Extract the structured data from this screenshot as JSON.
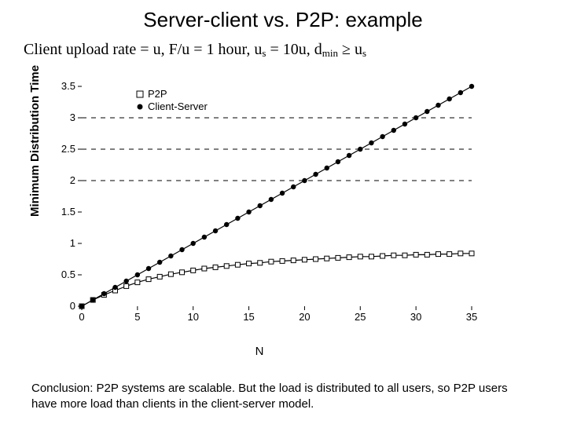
{
  "title": "Server-client vs. P2P: example",
  "assumptions_html": "Client upload rate = u,  F/u = 1 hour,  u<sub>s</sub> = 10u,  d<sub>min</sub> ≥ u<sub>s</sub>",
  "conclusion": "Conclusion: P2P systems are scalable. But the load is distributed to all users, so P2P users have more load than clients in the client-server model.",
  "ylabel": "Minimum Distribution Time",
  "xlabel": "N",
  "legend": {
    "p2p": "P2P",
    "cs": "Client-Server"
  },
  "chart_data": {
    "type": "line",
    "title": "",
    "xlabel": "N",
    "ylabel": "Minimum Distribution Time",
    "xlim": [
      0,
      35
    ],
    "ylim": [
      0,
      3.5
    ],
    "xticks": [
      0,
      5,
      10,
      15,
      20,
      25,
      30,
      35
    ],
    "yticks": [
      0,
      0.5,
      1,
      1.5,
      2,
      2.5,
      3,
      3.5
    ],
    "x": [
      0,
      1,
      2,
      3,
      4,
      5,
      6,
      7,
      8,
      9,
      10,
      11,
      12,
      13,
      14,
      15,
      16,
      17,
      18,
      19,
      20,
      21,
      22,
      23,
      24,
      25,
      26,
      27,
      28,
      29,
      30,
      31,
      32,
      33,
      34,
      35
    ],
    "horizontal_lines": [
      2,
      2.5,
      3
    ],
    "series": [
      {
        "name": "P2P",
        "marker": "square-open",
        "values": [
          0.0,
          0.1,
          0.18,
          0.25,
          0.32,
          0.38,
          0.43,
          0.47,
          0.51,
          0.54,
          0.57,
          0.6,
          0.62,
          0.64,
          0.66,
          0.68,
          0.69,
          0.71,
          0.72,
          0.73,
          0.74,
          0.75,
          0.76,
          0.77,
          0.78,
          0.79,
          0.79,
          0.8,
          0.81,
          0.81,
          0.82,
          0.82,
          0.83,
          0.83,
          0.84,
          0.84
        ]
      },
      {
        "name": "Client-Server",
        "marker": "circle-filled",
        "values": [
          0.0,
          0.1,
          0.2,
          0.3,
          0.4,
          0.5,
          0.6,
          0.7,
          0.8,
          0.9,
          1.0,
          1.1,
          1.2,
          1.3,
          1.4,
          1.5,
          1.6,
          1.7,
          1.8,
          1.9,
          2.0,
          2.1,
          2.2,
          2.3,
          2.4,
          2.5,
          2.6,
          2.7,
          2.8,
          2.9,
          3.0,
          3.1,
          3.2,
          3.3,
          3.4,
          3.5
        ]
      }
    ]
  }
}
